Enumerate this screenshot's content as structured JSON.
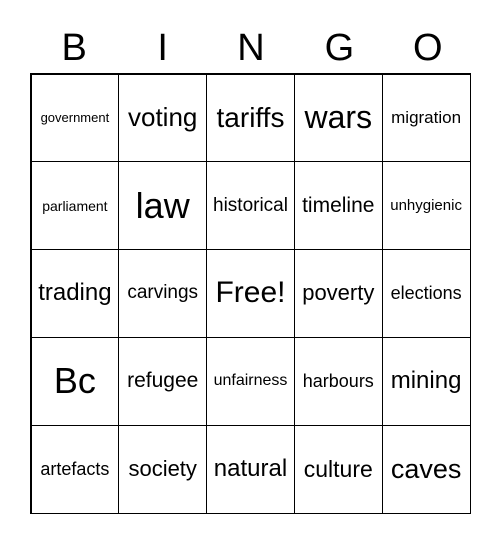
{
  "header": {
    "letters": [
      "B",
      "I",
      "N",
      "G",
      "O"
    ]
  },
  "card": {
    "cells": [
      "government",
      "voting",
      "tariffs",
      "wars",
      "migration",
      "parliament",
      "law",
      "historical",
      "timeline",
      "unhygienic",
      "trading",
      "carvings",
      "Free!",
      "poverty",
      "elections",
      "Bc",
      "refugee",
      "unfairness",
      "harbours",
      "mining",
      "artefacts",
      "society",
      "natural",
      "culture",
      "caves"
    ]
  }
}
